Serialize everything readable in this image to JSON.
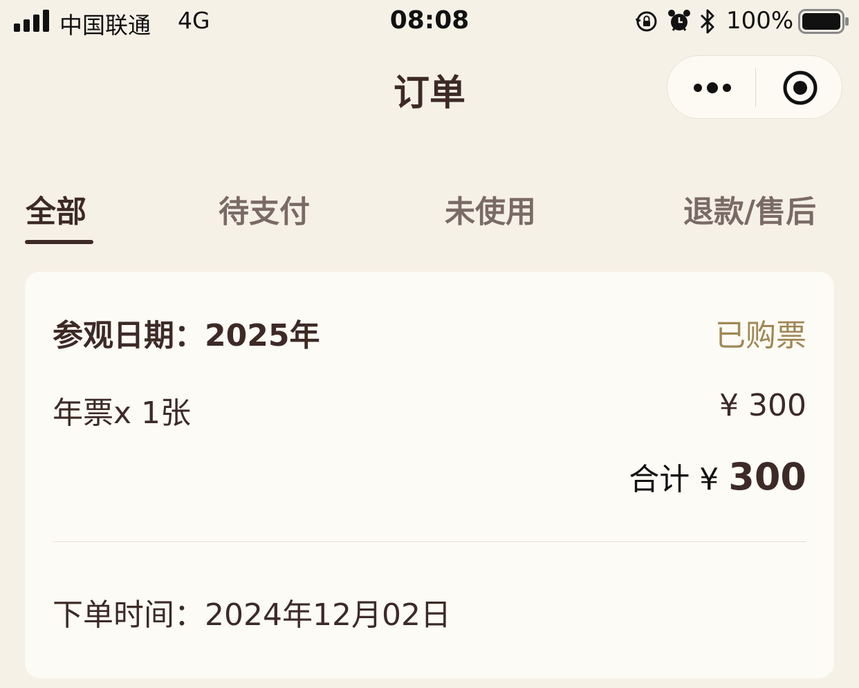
{
  "status_bar": {
    "carrier": "中国联通",
    "network": "4G",
    "time": "08:08",
    "battery": "100%"
  },
  "nav": {
    "title": "订单"
  },
  "tabs": [
    {
      "label": "全部",
      "active": true
    },
    {
      "label": "待支付",
      "active": false
    },
    {
      "label": "未使用",
      "active": false
    },
    {
      "label": "退款/售后",
      "active": false
    }
  ],
  "order": {
    "visit_date": "参观日期：2025年",
    "status": "已购票",
    "ticket": "年票x 1张",
    "price": "¥ 300",
    "total_label": "合计 ¥ ",
    "total_amount": "300",
    "order_time": "下单时间：2024年12月02日"
  },
  "colors": {
    "background": "#f6f1e7",
    "card": "#fdfbf5",
    "text_primary": "#3d2a26",
    "status_gold": "#a08755",
    "tab_inactive": "#7a6a65"
  },
  "icons": [
    "signal-icon",
    "screen-lock-icon",
    "alarm-icon",
    "bluetooth-icon",
    "battery-icon",
    "more-icon",
    "close-miniprogram-icon"
  ]
}
